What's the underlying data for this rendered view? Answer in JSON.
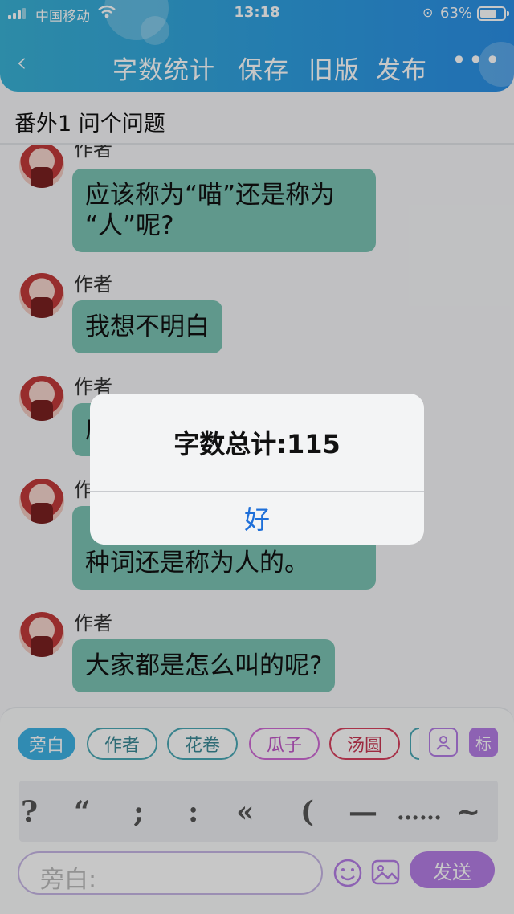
{
  "status_bar": {
    "carrier": "中国移动",
    "time": "13:18",
    "battery": "63%"
  },
  "nav": {
    "back_label": "‹",
    "items": [
      "字数统计",
      "保存",
      "旧版",
      "发布"
    ],
    "more_label": "•••"
  },
  "chapter_title": "番外1 问个问题",
  "messages": [
    {
      "sender": "作者",
      "text_lines": [
        "应该称为“喵”还是称为",
        "“人”呢?"
      ]
    },
    {
      "sender": "作者",
      "text_lines": [
        "我想不明白"
      ]
    },
    {
      "sender": "作者",
      "text_lines": [
        "应"
      ]
    },
    {
      "sender": "作者",
      "text_lines": [
        "",
        "种词还是称为人的。"
      ]
    },
    {
      "sender": "作者",
      "text_lines": [
        "大家都是怎么叫的呢?"
      ]
    }
  ],
  "roles": [
    "旁白",
    "作者",
    "花卷",
    "瓜子",
    "汤圆"
  ],
  "role_colors": [
    "#3eb2e5",
    "#4aa8b5",
    "#4aa8b5",
    "#d06bd6",
    "#d8405e"
  ],
  "tag_label": "标",
  "punctuation": [
    "?",
    "“",
    ";",
    ":",
    "«",
    "(",
    "—",
    "……",
    "~"
  ],
  "input": {
    "placeholder": "旁白:"
  },
  "send_label": "发送",
  "alert": {
    "message": "字数总计:115",
    "button": "好"
  }
}
